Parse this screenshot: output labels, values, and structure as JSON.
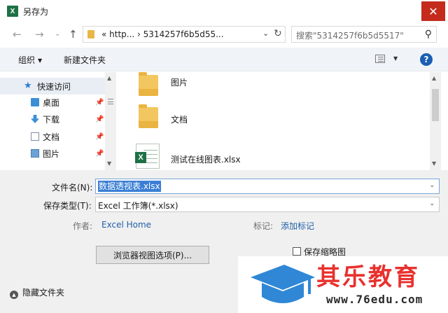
{
  "window": {
    "title": "另存为",
    "app_icon_letter": "X"
  },
  "address": {
    "path": "« http... › 5314257f6b5d55...",
    "search_placeholder": "搜索\"5314257f6b5d5517\""
  },
  "toolbar": {
    "organize": "组织",
    "new_folder": "新建文件夹",
    "help": "?"
  },
  "nav": {
    "quick_access": "快速访问",
    "items": [
      {
        "label": "桌面",
        "icon": "desktop-icon"
      },
      {
        "label": "下载",
        "icon": "download-icon"
      },
      {
        "label": "文档",
        "icon": "document-icon"
      },
      {
        "label": "图片",
        "icon": "pictures-icon"
      }
    ]
  },
  "files": [
    {
      "name": "图片",
      "type": "folder"
    },
    {
      "name": "文档",
      "type": "folder"
    },
    {
      "name": "测试在线图表.xlsx",
      "type": "xlsx"
    }
  ],
  "form": {
    "filename_label": "文件名(N):",
    "filename_value": "数据透视表.xlsx",
    "filetype_label": "保存类型(T):",
    "filetype_value": "Excel 工作簿(*.xlsx)",
    "author_label": "作者:",
    "author_value": "Excel Home",
    "tags_label": "标记:",
    "tags_value": "添加标记",
    "browser_options": "浏览器视图选项(P)...",
    "save_thumbnail": "保存缩略图",
    "hide_folders": "隐藏文件夹"
  },
  "watermark": {
    "title": "其乐教育",
    "url": "www.76edu.com"
  },
  "colors": {
    "accent": "#1a5fb4",
    "selection": "#3a7fd5",
    "close": "#c42b1c",
    "brand_red": "#e8312e",
    "excel_green": "#1e7145"
  }
}
